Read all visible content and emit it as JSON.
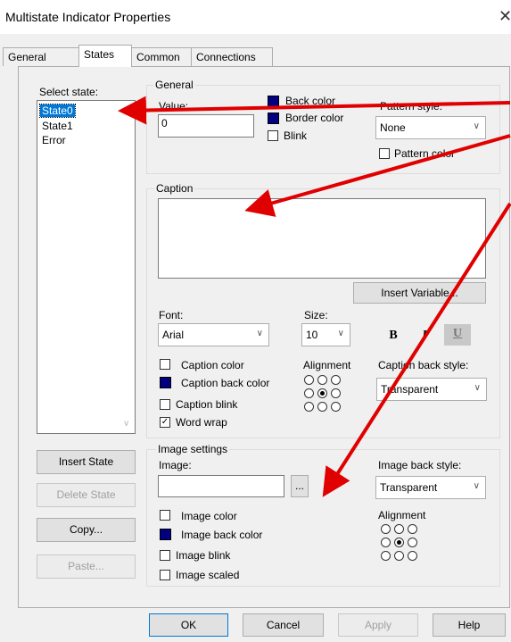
{
  "window": {
    "title": "Multistate Indicator Properties",
    "close_glyph": "✕"
  },
  "tabs": [
    "General",
    "States",
    "Common",
    "Connections"
  ],
  "states_panel": {
    "select_state_label": "Select state:",
    "states": [
      "State0",
      "State1",
      "Error"
    ],
    "selected_index": 0,
    "buttons": {
      "insert": "Insert State",
      "delete": "Delete State",
      "copy": "Copy...",
      "paste": "Paste..."
    }
  },
  "general_group": {
    "title": "General",
    "value_label": "Value:",
    "value": "0",
    "back_color_label": "Back color",
    "border_color_label": "Border color",
    "blink_label": "Blink",
    "pattern_style_label": "Pattern style:",
    "pattern_style_value": "None",
    "pattern_color_label": "Pattern color",
    "swatch_color": "#000080"
  },
  "caption_group": {
    "title": "Caption",
    "caption_text": "",
    "insert_variable_label": "Insert Variable...",
    "font_label": "Font:",
    "font_value": "Arial",
    "size_label": "Size:",
    "size_value": "10",
    "bold": "B",
    "italic": "I",
    "underline": "U",
    "caption_color_label": "Caption color",
    "caption_back_color_label": "Caption back color",
    "caption_blink_label": "Caption blink",
    "word_wrap_label": "Word wrap",
    "word_wrap_checked": true,
    "alignment_label": "Alignment",
    "caption_back_style_label": "Caption back style:",
    "caption_back_style_value": "Transparent"
  },
  "image_group": {
    "title": "Image settings",
    "image_label": "Image:",
    "browse_label": "...",
    "image_back_style_label": "Image back style:",
    "image_back_style_value": "Transparent",
    "alignment_label": "Alignment",
    "image_color_label": "Image color",
    "image_back_color_label": "Image back color",
    "image_blink_label": "Image blink",
    "image_scaled_label": "Image scaled"
  },
  "footer": {
    "ok": "OK",
    "cancel": "Cancel",
    "apply": "Apply",
    "help": "Help"
  },
  "colors": {
    "annotation_arrow": "#e00000",
    "selection": "#0078d7",
    "swatch": "#000080"
  }
}
